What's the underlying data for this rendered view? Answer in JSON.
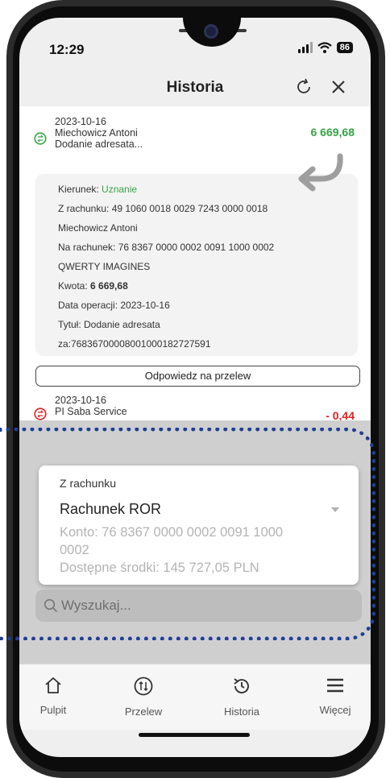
{
  "status": {
    "time": "12:29",
    "battery": "86"
  },
  "header": {
    "title": "Historia"
  },
  "transactions": [
    {
      "date": "2023-10-16",
      "name": "Miechowicz Antoni",
      "desc": "Dodanie adresata...",
      "amount": "6 669,68"
    },
    {
      "date": "2023-10-16",
      "name": "PI Saba Service",
      "amount": "- 0,44"
    }
  ],
  "details": {
    "kierunek_label": "Kierunek: ",
    "kierunek_value": "Uznanie",
    "z_rachunku": "Z rachunku: 49 1060 0018 0029 7243 0000 0018",
    "z_nazwa": "Miechowicz Antoni",
    "na_rachunek": "Na rachunek: 76 8367 0000 0002 0091 1000 0002",
    "na_nazwa": "QWERTY IMAGINES",
    "kwota_label": "Kwota: ",
    "kwota_value": "6 669,68",
    "data_operacji": "Data operacji: 2023-10-16",
    "tytul": "Tytuł: Dodanie adresata",
    "tytul_cd": "za:76836700008001000182727591"
  },
  "reply_button": "Odpowiedz na przelew",
  "account_card": {
    "label": "Z rachunku",
    "account_name": "Rachunek ROR",
    "konto_line1": "Konto: 76 8367 0000 0002 0091 1000",
    "konto_line2": "0002",
    "srodki": "Dostępne środki: 145 727,05 PLN"
  },
  "search": {
    "placeholder": "Wyszukaj..."
  },
  "nav": [
    {
      "label": "Pulpit",
      "icon": "home-icon"
    },
    {
      "label": "Przelew",
      "icon": "transfer-icon"
    },
    {
      "label": "Historia",
      "icon": "history-icon"
    },
    {
      "label": "Więcej",
      "icon": "menu-icon"
    }
  ],
  "colors": {
    "positive": "#36a345",
    "negative": "#e02020",
    "highlight": "#1f3f96"
  }
}
